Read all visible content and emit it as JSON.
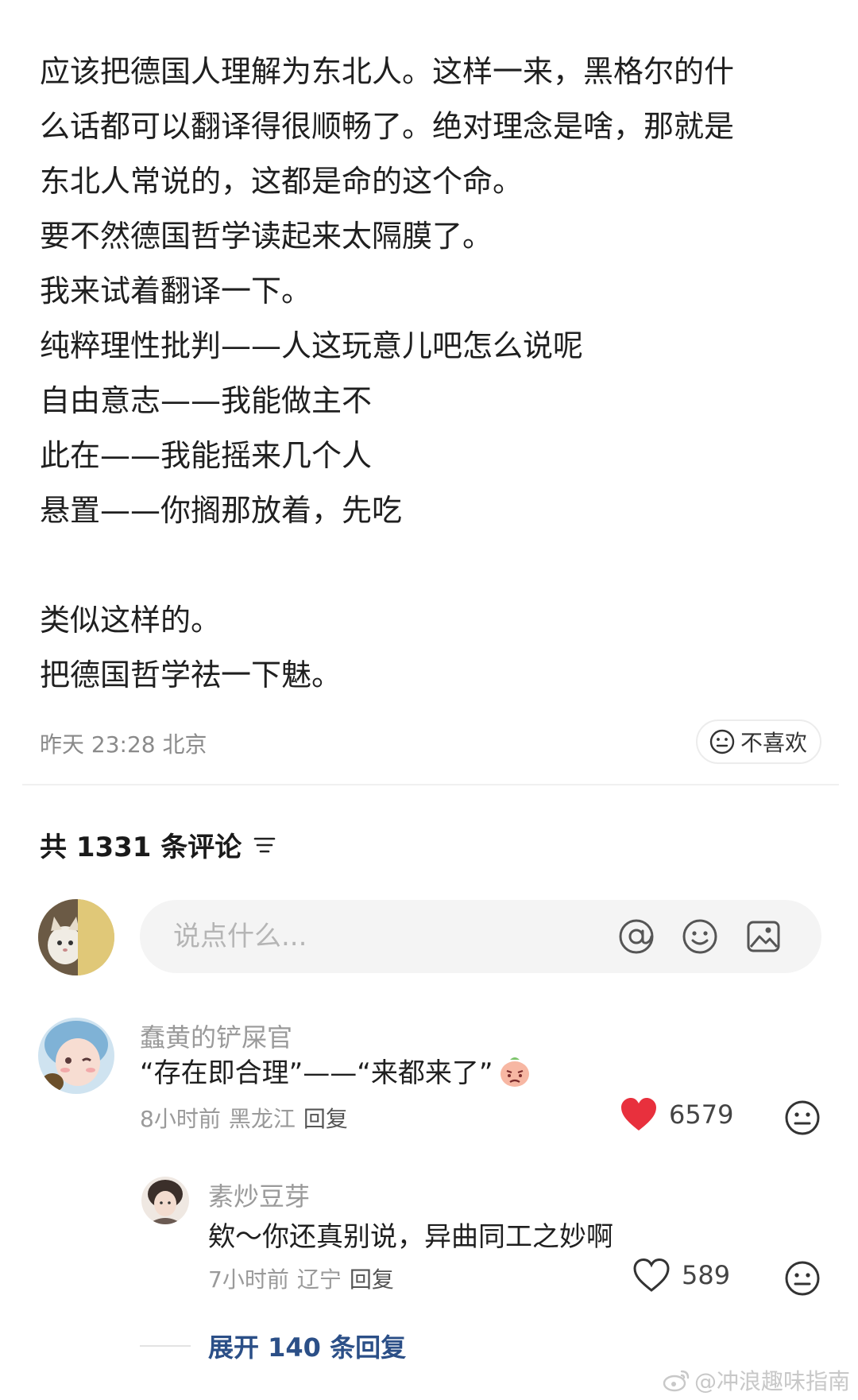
{
  "post": {
    "lines": [
      "应该把德国人理解为东北人。这样一来，黑格尔的什",
      "么话都可以翻译得很顺畅了。绝对理念是啥，那就是",
      "东北人常说的，这都是命的这个命。",
      "要不然德国哲学读起来太隔膜了。",
      "我来试着翻译一下。",
      "纯粹理性批判——人这玩意儿吧怎么说呢",
      "自由意志——我能做主不",
      "此在——我能摇来几个人",
      "悬置——你搁那放着，先吃",
      "类似这样的。",
      "把德国哲学祛一下魅。"
    ],
    "time_location": "昨天 23:28 北京",
    "dislike_label": "不喜欢"
  },
  "comments_header": {
    "count_label": "共 1331 条评论"
  },
  "composer": {
    "placeholder": "说点什么..."
  },
  "comments": [
    {
      "author": "蠢黄的铲屎官",
      "text": "“存在即合理”——“来都来了”",
      "time": "8小时前",
      "location": "黑龙江",
      "reply_label": "回复",
      "likes": "6579",
      "liked": true
    },
    {
      "author": "素炒豆芽",
      "text": "欸～你还真别说，异曲同工之妙啊",
      "time": "7小时前",
      "location": "辽宁",
      "reply_label": "回复",
      "likes": "589",
      "liked": false
    }
  ],
  "expand_replies": {
    "label": "展开 140 条回复"
  },
  "watermark": {
    "text": "@冲浪趣味指南"
  },
  "colors": {
    "like_red": "#e8303d",
    "link_blue": "#2b4f87",
    "muted_gray": "#9a9a9a"
  },
  "icons": {
    "dislike": "neutral-face-icon",
    "sort": "sort-lines-icon",
    "at": "at-sign-icon",
    "emoji": "smile-face-icon",
    "image": "image-icon",
    "like": "heart-icon",
    "watermark": "weibo-logo-icon"
  }
}
